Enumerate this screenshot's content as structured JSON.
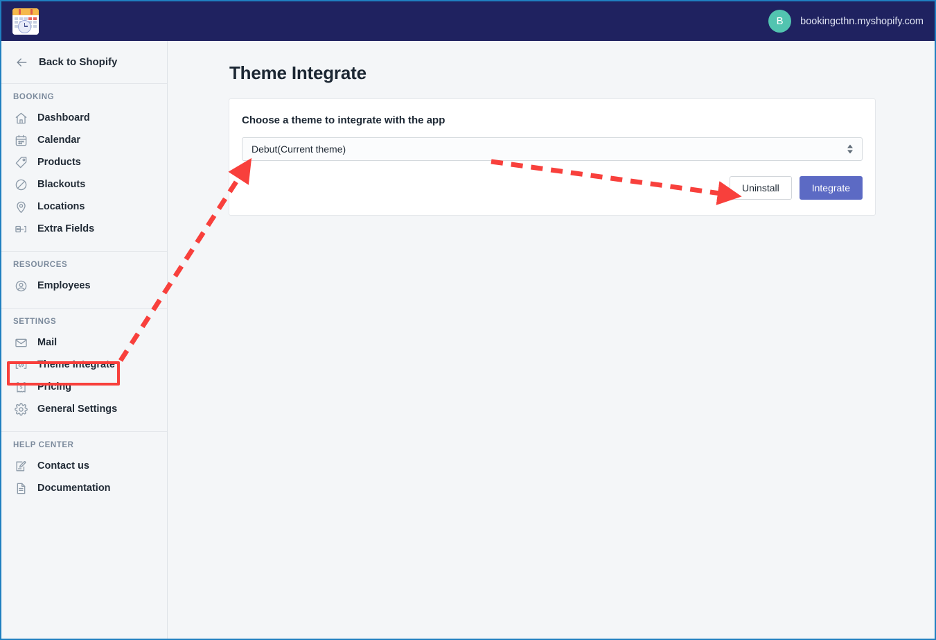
{
  "header": {
    "logo_icon": "calendar-clock-logo",
    "store_name": "bookingcthn.myshopify.com",
    "avatar_initial": "B",
    "background_color": "#1f2260",
    "avatar_color": "#52c4b0"
  },
  "sidebar": {
    "back": {
      "label": "Back to Shopify",
      "icon": "arrow-left-icon"
    },
    "sections": [
      {
        "title": "BOOKING",
        "items": [
          {
            "label": "Dashboard",
            "icon": "home-icon"
          },
          {
            "label": "Calendar",
            "icon": "calendar-icon"
          },
          {
            "label": "Products",
            "icon": "tag-icon"
          },
          {
            "label": "Blackouts",
            "icon": "no-entry-icon"
          },
          {
            "label": "Locations",
            "icon": "map-pin-icon"
          },
          {
            "label": "Extra Fields",
            "icon": "form-fields-icon"
          }
        ]
      },
      {
        "title": "RESOURCES",
        "items": [
          {
            "label": "Employees",
            "icon": "user-circle-icon"
          }
        ]
      },
      {
        "title": "SETTINGS",
        "items": [
          {
            "label": "Mail",
            "icon": "envelope-icon"
          },
          {
            "label": "Theme Integrate",
            "icon": "code-brackets-icon"
          },
          {
            "label": "Pricing",
            "icon": "receipt-dollar-icon"
          },
          {
            "label": "General Settings",
            "icon": "gear-icon"
          }
        ]
      },
      {
        "title": "HELP CENTER",
        "items": [
          {
            "label": "Contact us",
            "icon": "pencil-edit-icon"
          },
          {
            "label": "Documentation",
            "icon": "document-icon"
          }
        ]
      }
    ]
  },
  "main": {
    "page_title": "Theme Integrate",
    "card": {
      "heading": "Choose a theme to integrate with the app",
      "theme_select": {
        "selected_value": "Debut(Current theme)",
        "options": [
          "Debut(Current theme)"
        ]
      },
      "buttons": {
        "uninstall_label": "Uninstall",
        "integrate_label": "Integrate"
      }
    }
  },
  "annotations": {
    "highlight_color": "#f8403c",
    "highlighted_item": "Theme Integrate",
    "arrows": [
      {
        "from": "theme-integrate-sidebar-item",
        "to": "theme-select"
      },
      {
        "from": "theme-select",
        "to": "uninstall-button"
      }
    ]
  },
  "colors": {
    "page_background": "#f4f6f8",
    "primary_button": "#5c6ac4",
    "frame_border": "#1f7fc0"
  }
}
